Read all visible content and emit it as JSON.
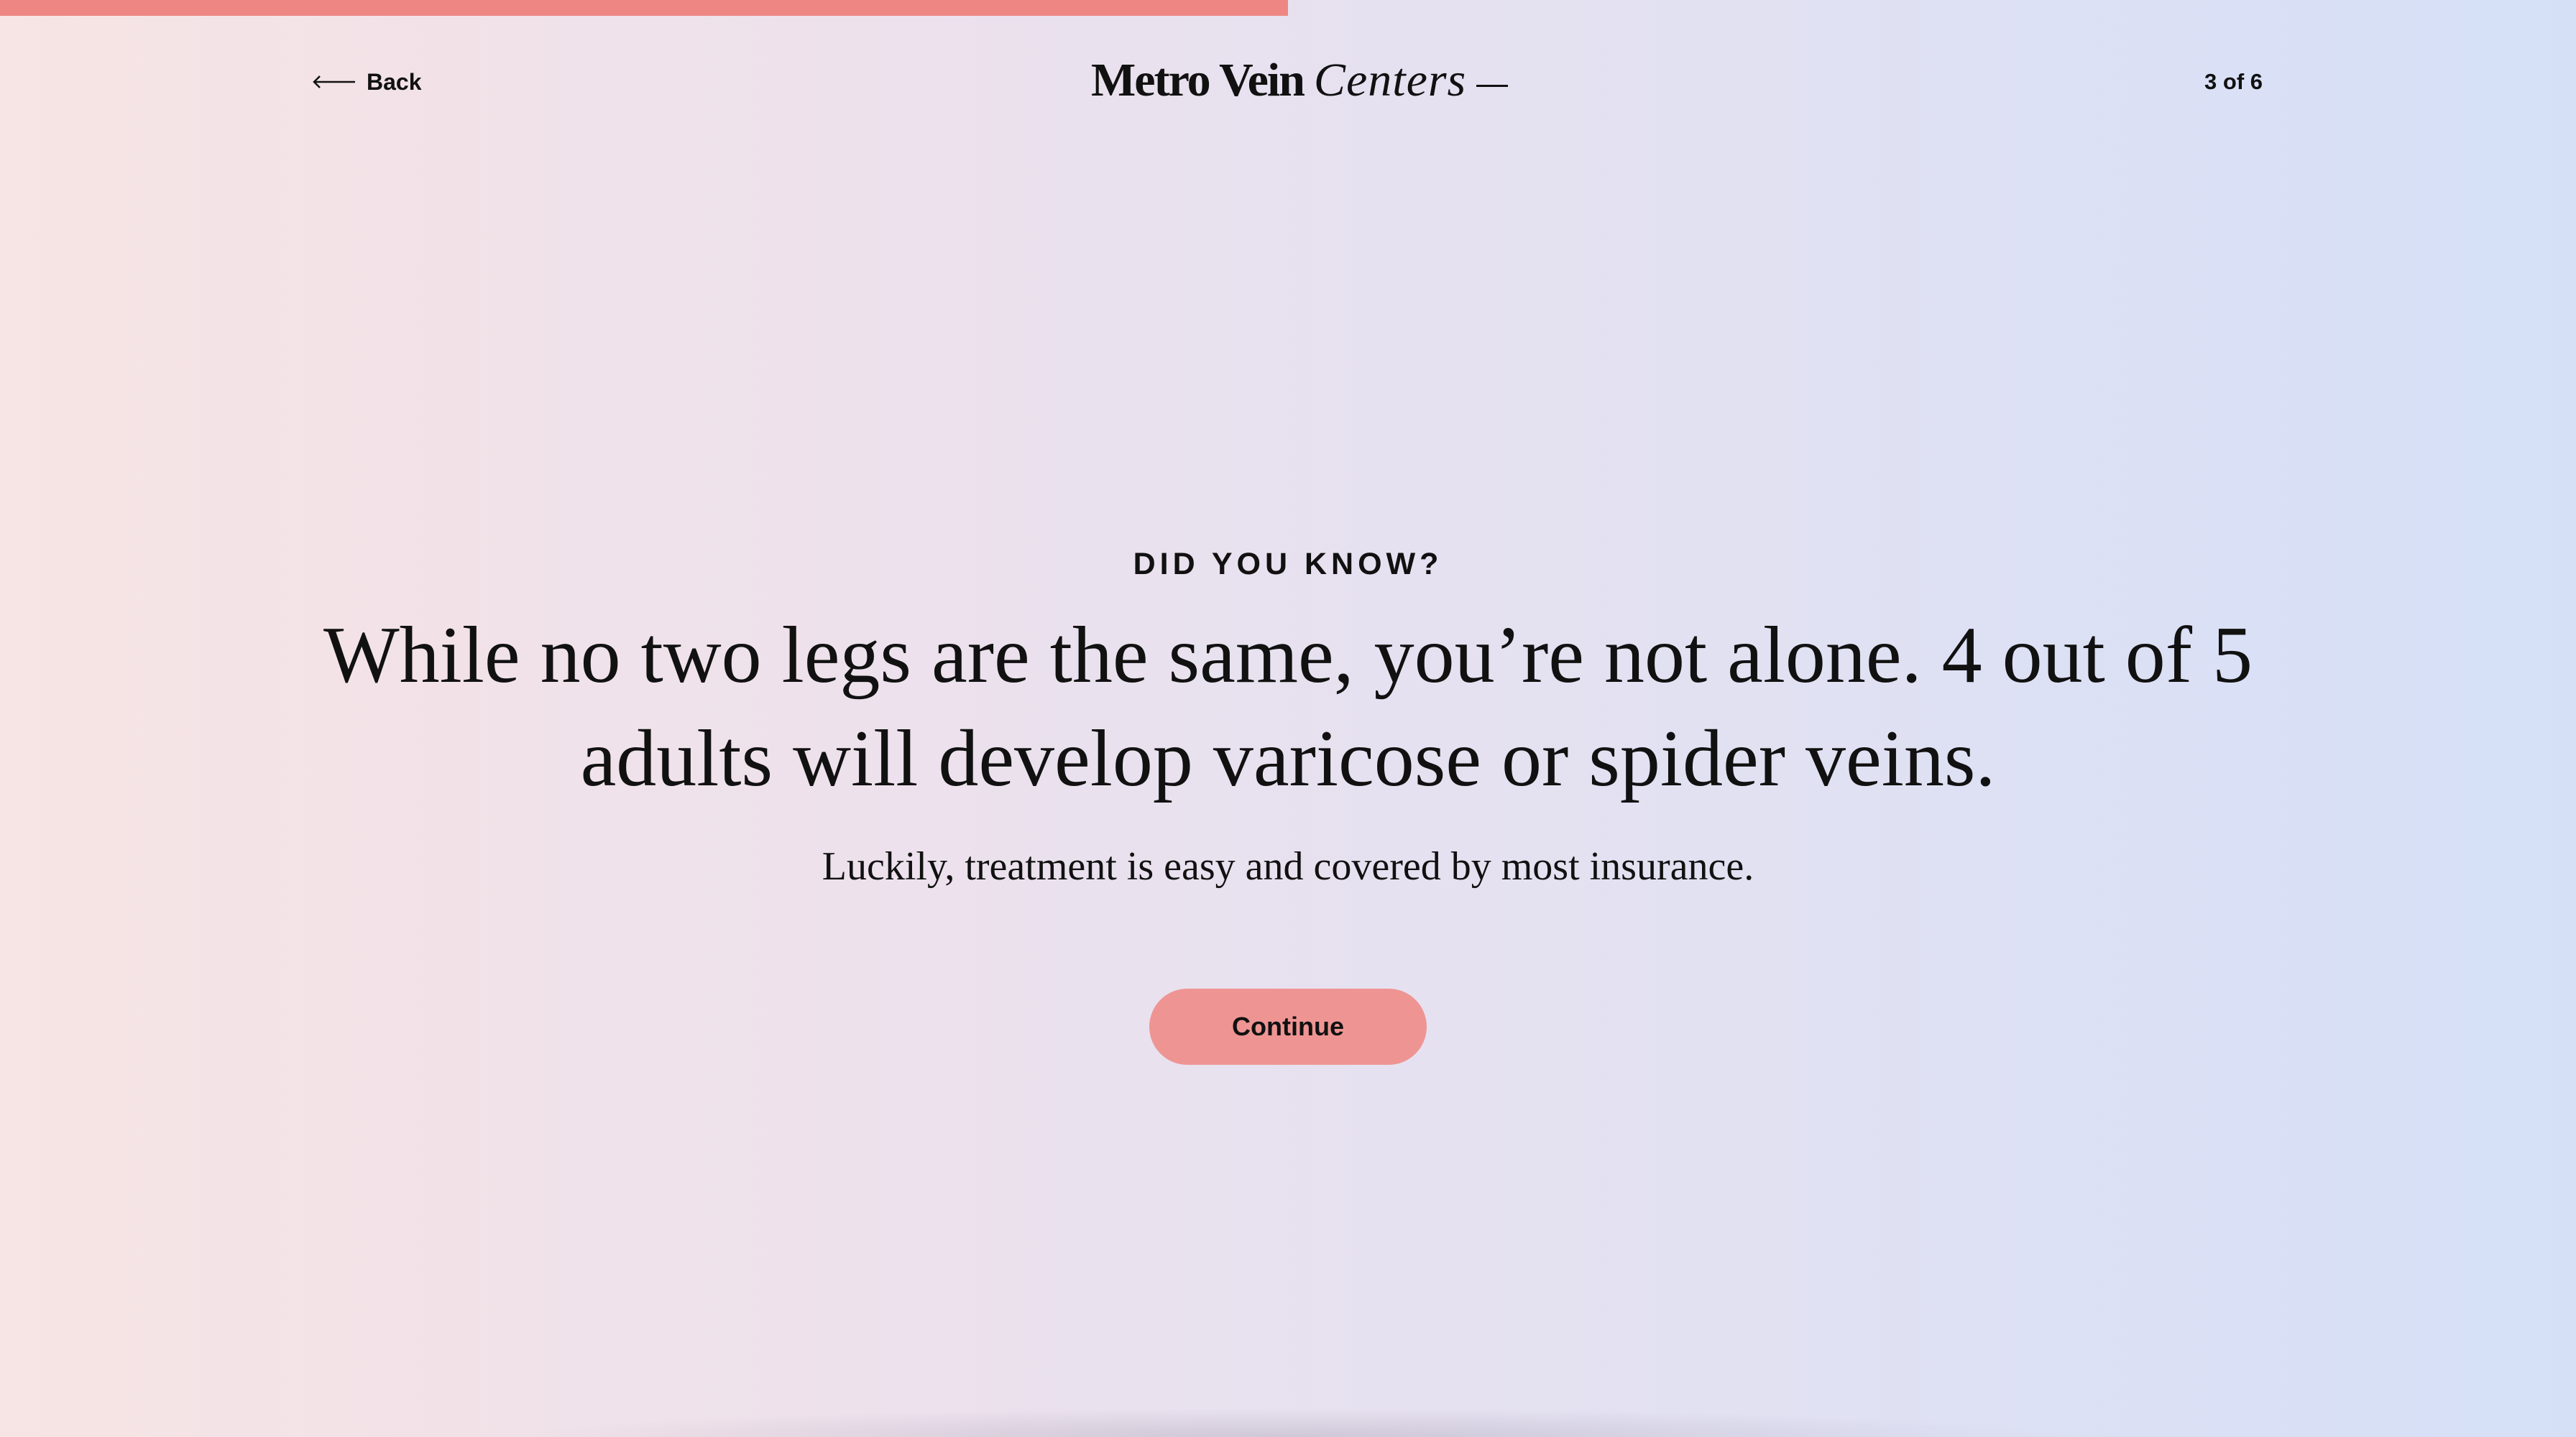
{
  "progress": {
    "fraction": 0.5,
    "color": "#ee8784"
  },
  "header": {
    "back_label": "Back",
    "back_icon": "arrow-left-icon",
    "logo": {
      "strong": "Metro Vein",
      "italic": "Centers"
    },
    "step_counter": "3 of 6"
  },
  "main": {
    "eyebrow": "DID YOU KNOW?",
    "headline": "While no two legs are the same, you’re not alone. 4 out of 5 adults will develop varicose or spider veins.",
    "subtext": "Luckily, treatment is easy and covered by most insurance.",
    "continue_label": "Continue"
  },
  "colors": {
    "accent": "#ee9593",
    "text": "#111111",
    "background_left": "#f7e4e4",
    "background_right": "#d5e0f7"
  }
}
